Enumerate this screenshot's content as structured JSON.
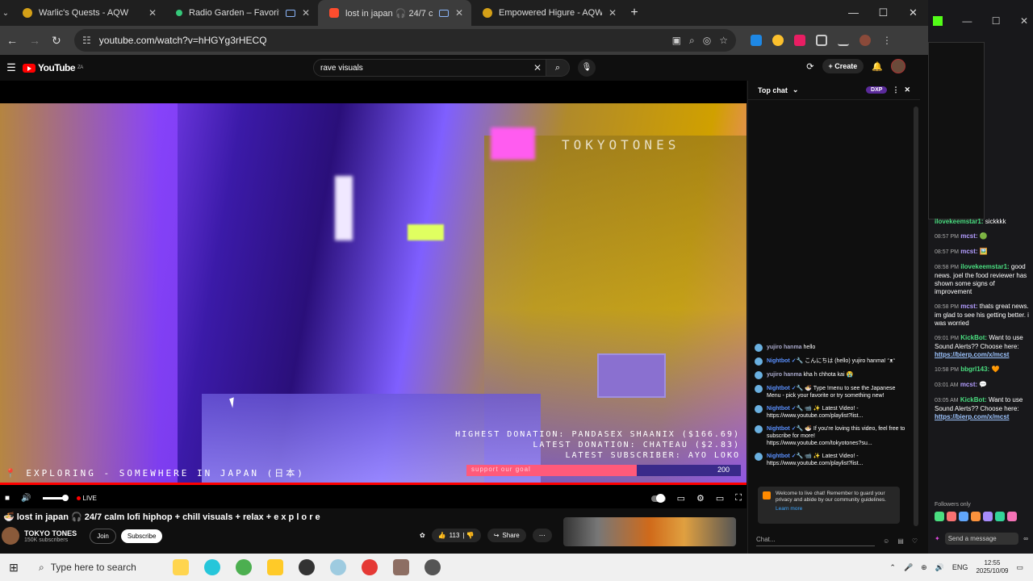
{
  "tabs": [
    {
      "title": "Warlic's Quests - AQW",
      "color": "#d4a017",
      "active": false
    },
    {
      "title": "Radio Garden – Favorites",
      "color": "#35c87a",
      "active": false
    },
    {
      "title": "lost in japan 🎧 24/7 c",
      "color": "#ff4d2e",
      "active": true
    },
    {
      "title": "Empowered Higure - AQW",
      "color": "#d4a017",
      "active": false
    }
  ],
  "address": {
    "url": "youtube.com/watch?v=hHGYg3rHECQ"
  },
  "youtube": {
    "logo": "YouTube",
    "logo_country": "ZA",
    "search_value": "rave visuals",
    "create_label": "Create",
    "video": {
      "watermark": "TOKYOTONES",
      "highest_donation": "HIGHEST DONATION: PANDASEX SHAANIX ($166.69)",
      "latest_donation": "LATEST DONATION: CHATEAU ($2.83)",
      "latest_subscriber": "LATEST SUBSCRIBER: AYO LOKO",
      "exploring": "📍 EXPLORING - SOMEWHERE IN JAPAN (日本)",
      "goal_left": "support our goal",
      "goal_right": "200",
      "goal_progress": 0.62,
      "live_label": "LIVE"
    },
    "title": "🍜 lost in japan 🎧 24/7 calm lofi hiphop + chill visuals + relax + e x p l o r e",
    "channel_name": "TOKYO TONES",
    "channel_subs": "150K subscribers",
    "join_label": "Join",
    "subscribe_label": "Subscribe",
    "likes": "113",
    "share_label": "Share"
  },
  "chat": {
    "mode": "Top chat",
    "badge": "DXP",
    "messages": [
      {
        "author": "yujiro hanma",
        "text": "hello",
        "bot": false
      },
      {
        "author": "Nightbot ✓🔧",
        "text": "こんにちは (hello) yujiro hanma! ᵔᴥᵔ",
        "bot": true
      },
      {
        "author": "yujiro hanma",
        "text": "kha h chhota kai 😭",
        "bot": false
      },
      {
        "author": "Nightbot ✓🔧",
        "text": "🍜 Type !menu to see the Japanese Menu - pick your favorite or try something new!",
        "bot": true
      },
      {
        "author": "Nightbot ✓🔧",
        "text": "📹 ✨ Latest Video! - https://www.youtube.com/playlist?list...",
        "bot": true
      },
      {
        "author": "Nightbot ✓🔧",
        "text": "🍜 If you're loving this video, feel free to subscribe for more! https://www.youtube.com/tokyotones?su...",
        "bot": true
      },
      {
        "author": "Nightbot ✓🔧",
        "text": "📹 ✨ Latest Video! - https://www.youtube.com/playlist?list...",
        "bot": true
      }
    ],
    "welcome": "Welcome to live chat! Remember to guard your privacy and abide by our community guidelines.",
    "learn_more": "Learn more",
    "input_placeholder": "Chat..."
  },
  "twitch": {
    "messages": [
      {
        "time": "",
        "user": "ilovekeemstar1:",
        "cls": "g",
        "text": "sickkkk"
      },
      {
        "time": "08:57 PM",
        "user": "mcst:",
        "cls": "p",
        "text": "🟢"
      },
      {
        "time": "08:57 PM",
        "user": "mcst:",
        "cls": "p",
        "text": "🖼️"
      },
      {
        "time": "08:58 PM",
        "user": "ilovekeemstar1:",
        "cls": "g",
        "text": "good news. joel the food reviewer has shown some signs of improvement"
      },
      {
        "time": "08:58 PM",
        "user": "mcst:",
        "cls": "p",
        "text": "thats great news. im glad to see his getting better. i was worried"
      },
      {
        "time": "09:01 PM",
        "user": "KickBot:",
        "cls": "g",
        "text": "Want to use Sound Alerts?? Choose here:",
        "link": "https://bierp.com/x/mcst"
      },
      {
        "time": "10:58 PM",
        "user": "bbgrl143:",
        "cls": "g",
        "text": "🧡"
      },
      {
        "time": "03:01 AM",
        "user": "mcst:",
        "cls": "p",
        "text": "💬"
      },
      {
        "time": "03:05 AM",
        "user": "KickBot:",
        "cls": "g",
        "text": "Want to use Sound Alerts?? Choose here:",
        "link": "https://bierp.com/x/mcst"
      }
    ],
    "followers_only": "Followers only",
    "send_placeholder": "Send a message"
  },
  "taskbar": {
    "search_placeholder": "Type here to search",
    "lang": "ENG",
    "time": "12:55",
    "date": "2025/10/09"
  }
}
